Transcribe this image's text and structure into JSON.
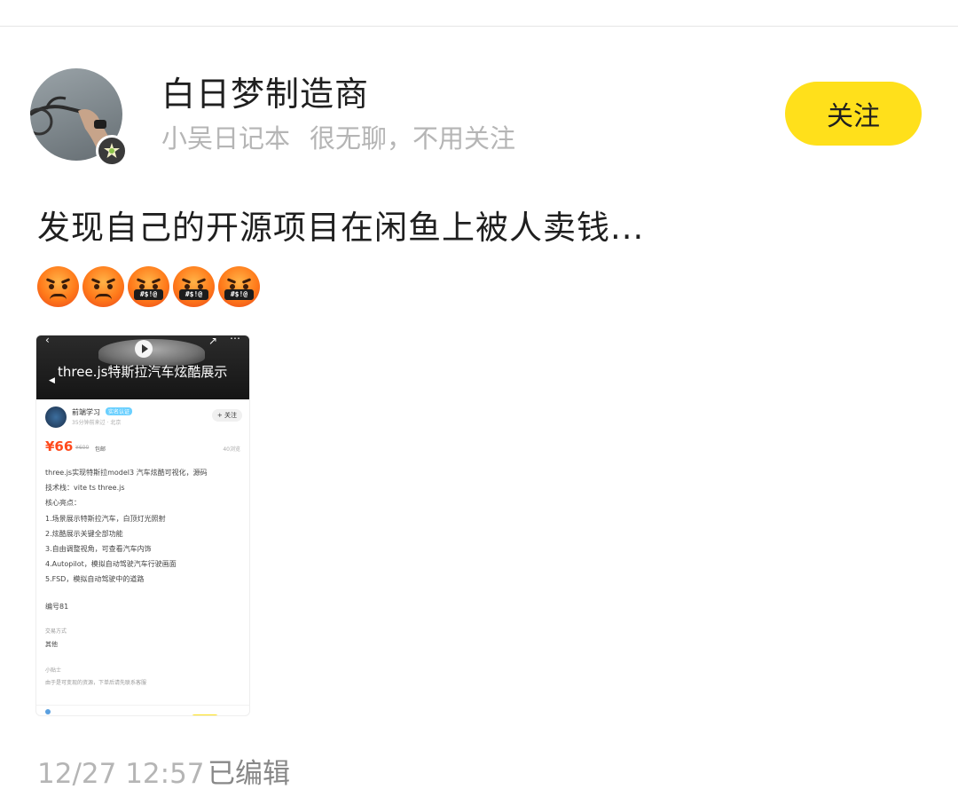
{
  "author": {
    "name": "白日梦制造商",
    "subtitle_prefix": "小吴日记本",
    "subtitle_bio": "很无聊，不用关注",
    "follow_label": "关注"
  },
  "post": {
    "title": "发现自己的开源项目在闲鱼上被人卖钱...",
    "emojis": [
      "angry-face",
      "angry-face",
      "cursing-face",
      "cursing-face",
      "cursing-face"
    ],
    "emoji_gag_text": "#$!@",
    "timestamp": "12/27 12:57",
    "edited_label": "已编辑"
  },
  "screenshot": {
    "video_caption": "three.js特斯拉汽车炫酷展示",
    "seller_name": "前端学习",
    "seller_tag": "实名认证",
    "seller_sub": "35分钟前来过 · 北京",
    "seller_follow": "+ 关注",
    "price": "¥66",
    "price_old": "¥600",
    "price_note": "包邮",
    "views": "40浏览",
    "description_lines": [
      "three.js实现特斯拉model3 汽车炫酷可视化，源码",
      "技术栈：vite ts three.js",
      "核心亮点：",
      "1.场景展示特斯拉汽车，白顶灯光照射",
      "2.炫酷展示关键全部功能",
      "3.自由调整视角，可查看汽车内饰",
      "4.Autopilot，模拟自动驾驶汽车行驶画面",
      "5.FSD，模拟自动驾驶中的道路"
    ],
    "code_label": "编号81",
    "trade_label": "交易方式",
    "trade_value": "其他",
    "tips_label": "小贴士",
    "tips_value": "由于是可变现的资源，下单后请先联系客服"
  },
  "colors": {
    "accent_yellow": "#ffe01b",
    "price_orange": "#ff4a1c",
    "muted_gray": "#b5b5b5"
  }
}
